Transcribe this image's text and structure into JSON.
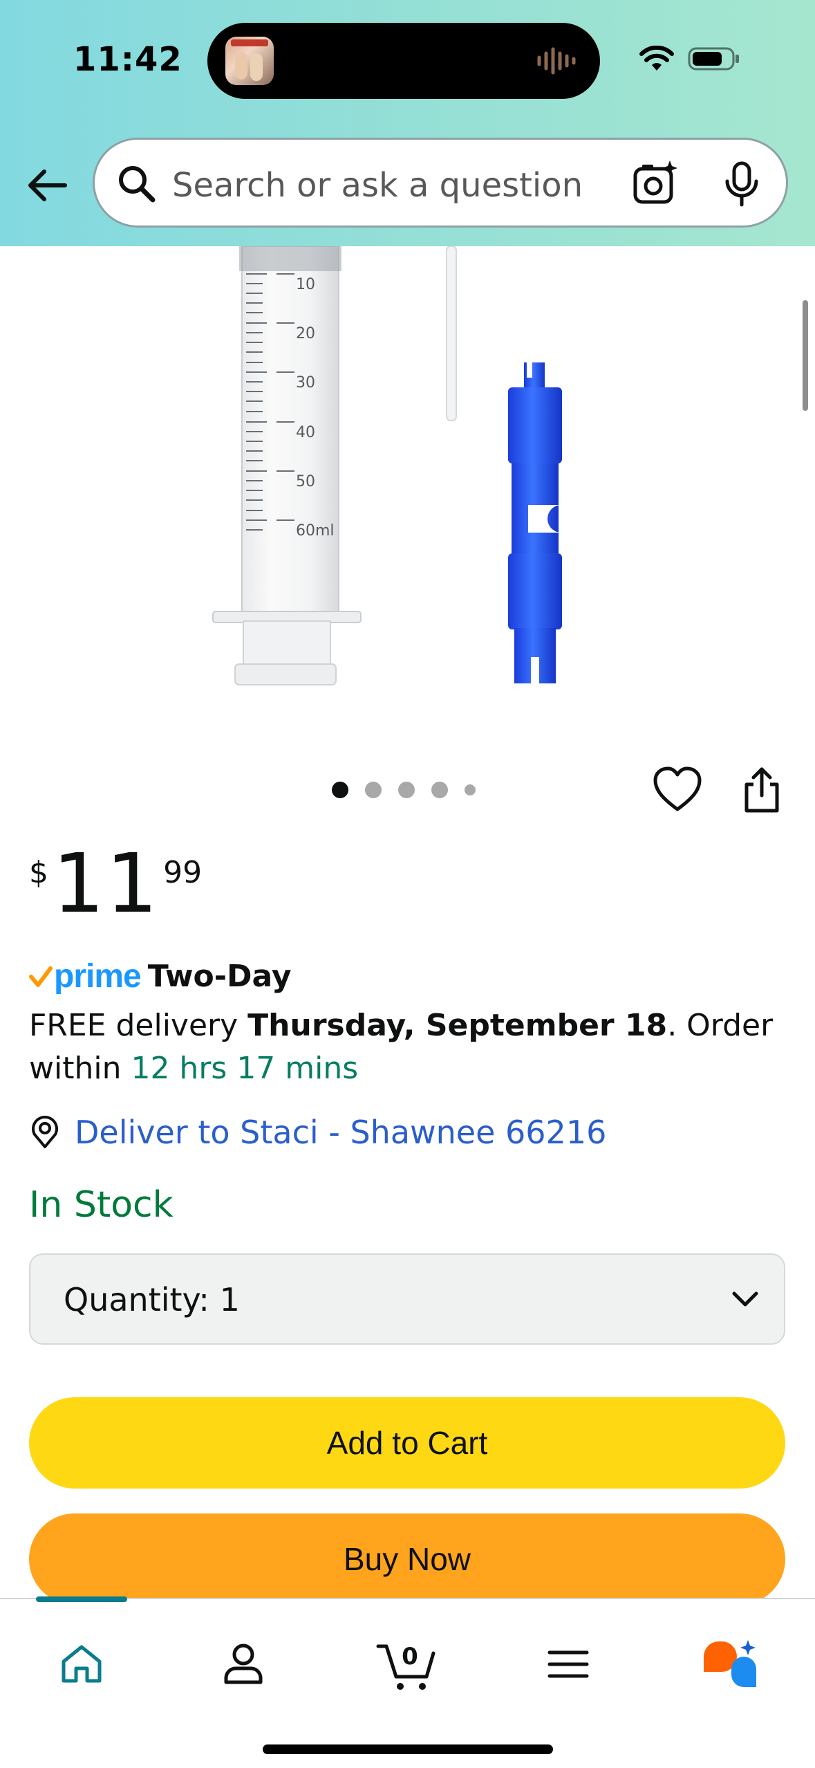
{
  "status_bar": {
    "time": "11:42"
  },
  "header": {
    "search": {
      "placeholder": "Search or ask a question"
    },
    "icons": [
      "back-arrow-icon",
      "search-icon",
      "camera-lens-icon",
      "microphone-icon"
    ]
  },
  "product": {
    "image_markings": [
      "10",
      "20",
      "30",
      "40",
      "50",
      "60ml"
    ],
    "carousel": {
      "total_images": 5,
      "active_index": 0
    },
    "price": {
      "symbol": "$",
      "whole": "11",
      "fraction": "99"
    },
    "prime": {
      "brand": "prime",
      "speed": "Two-Day"
    },
    "delivery": {
      "prefix": "FREE delivery ",
      "date": "Thursday, September 18",
      "middle": ". Order within ",
      "countdown": "12 hrs 17 mins"
    },
    "deliver_to": "Deliver to Staci - Shawnee 66216",
    "availability": "In Stock",
    "quantity": {
      "label": "Quantity:",
      "value": "1"
    },
    "buttons": {
      "add_to_cart": "Add to Cart",
      "buy_now": "Buy Now"
    }
  },
  "bottom_nav": {
    "items": [
      "home-icon",
      "account-icon",
      "cart-icon",
      "menu-icon",
      "rufus-assistant-icon"
    ],
    "cart_count": "0",
    "active": "home-icon"
  },
  "colors": {
    "header_gradient_start": "#83d9e0",
    "header_gradient_end": "#a5e6cf",
    "prime_blue": "#1a98ff",
    "prime_check": "#ff9900",
    "countdown_green": "#067d62",
    "link_blue": "#2a5ecb",
    "in_stock_green": "#007a3d",
    "add_to_cart_yellow": "#fed813",
    "buy_now_orange": "#ffa41c",
    "nav_active_teal": "#0b7c8e"
  }
}
